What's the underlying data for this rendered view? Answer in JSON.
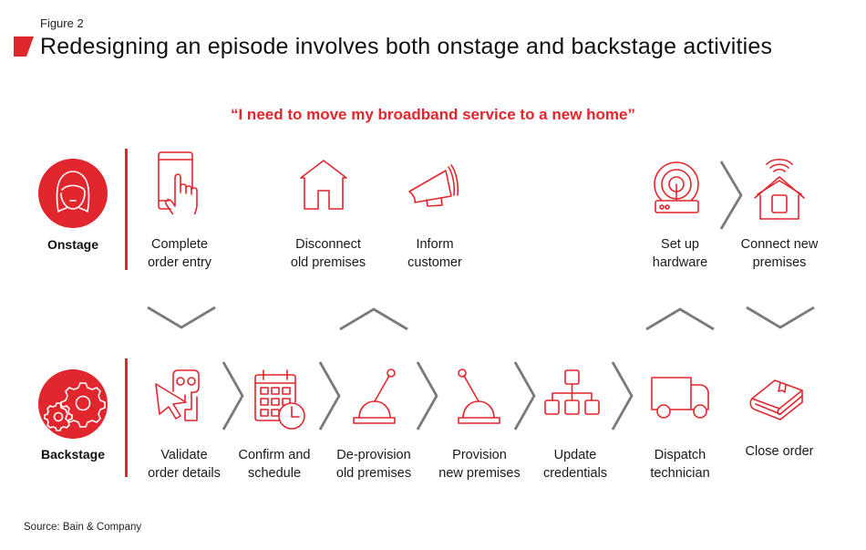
{
  "figure_label": "Figure 2",
  "title": "Redesigning an episode involves both onstage and backstage activities",
  "quote": "“I need to move my broadband service to a new home”",
  "colors": {
    "accent": "#e1262d",
    "chevron": "#7a7a7a",
    "text": "#1a1a1a"
  },
  "onstage": {
    "label": "Onstage",
    "icon": "person-icon",
    "steps": [
      {
        "line1": "Complete",
        "line2": "order entry",
        "icon": "phone-touch-icon"
      },
      {
        "line1": "Disconnect",
        "line2": "old premises",
        "icon": "house-icon"
      },
      {
        "line1": "Inform",
        "line2": "customer",
        "icon": "megaphone-icon"
      },
      {
        "line1": "Set up",
        "line2": "hardware",
        "icon": "router-icon"
      },
      {
        "line1": "Connect new",
        "line2": "premises",
        "icon": "wifi-house-icon"
      }
    ]
  },
  "backstage": {
    "label": "Backstage",
    "icon": "gears-icon",
    "steps": [
      {
        "line1": "Validate",
        "line2": "order details",
        "icon": "cursor-robot-icon"
      },
      {
        "line1": "Confirm and",
        "line2": "schedule",
        "icon": "calendar-clock-icon"
      },
      {
        "line1": "De-provision",
        "line2": "old premises",
        "icon": "lever-icon"
      },
      {
        "line1": "Provision",
        "line2": "new premises",
        "icon": "lever-icon"
      },
      {
        "line1": "Update",
        "line2": "credentials",
        "icon": "hierarchy-icon"
      },
      {
        "line1": "Dispatch",
        "line2": "technician",
        "icon": "truck-icon"
      },
      {
        "line1": "Close order",
        "line2": "",
        "icon": "book-icon"
      }
    ]
  },
  "transitions": [
    {
      "from": "Complete order entry",
      "to": "Validate order details",
      "direction": "down"
    },
    {
      "from": "De-provision old premises",
      "to": "Disconnect old premises",
      "direction": "up"
    },
    {
      "from": "Dispatch technician",
      "to": "Set up hardware",
      "direction": "up"
    },
    {
      "from": "Connect new premises",
      "to": "Close order",
      "direction": "down"
    }
  ],
  "source": "Source: Bain & Company"
}
